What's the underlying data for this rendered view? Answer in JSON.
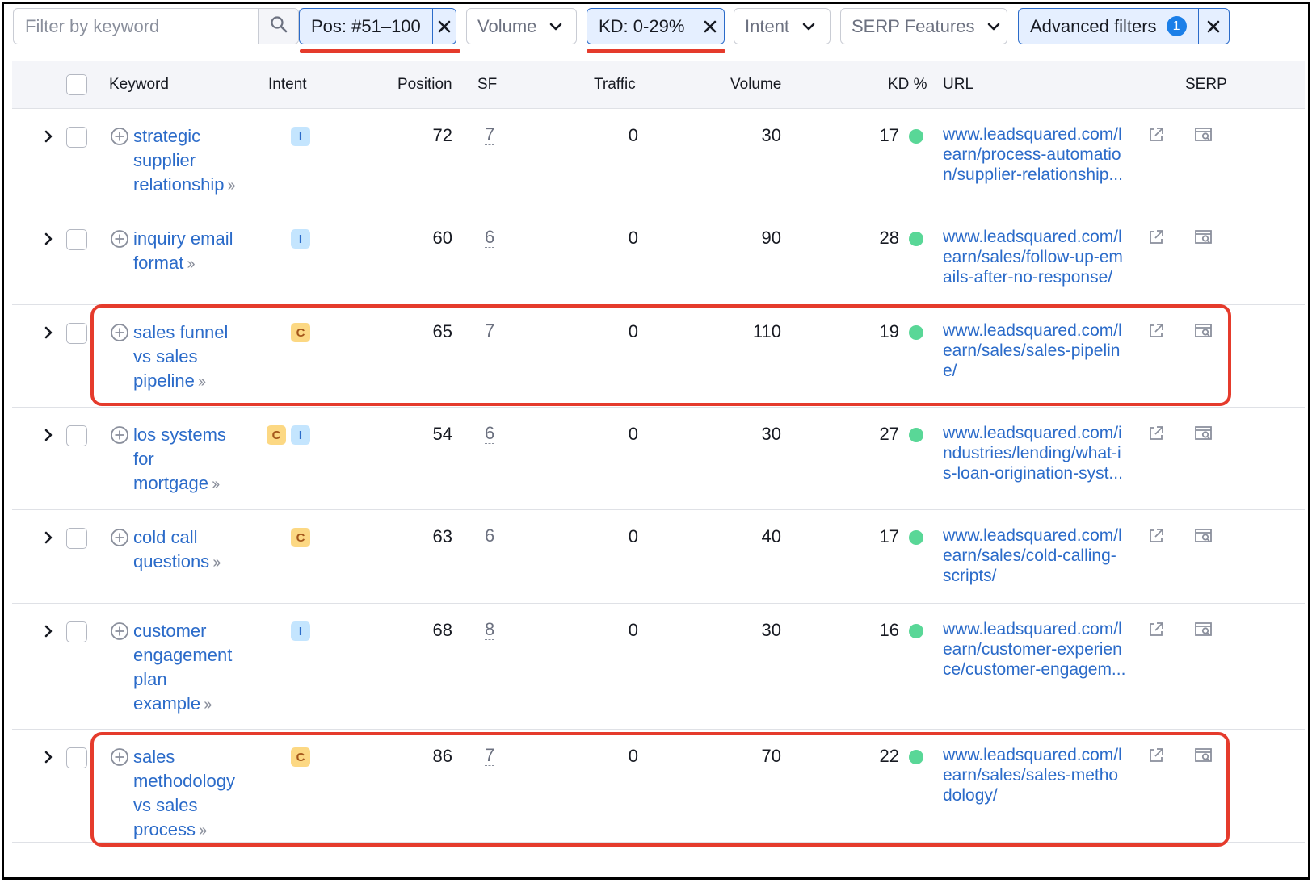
{
  "search": {
    "placeholder": "Filter by keyword"
  },
  "filters": {
    "position_chip": "Pos: #51–100",
    "volume_dropdown": "Volume",
    "kd_chip": "KD: 0-29%",
    "intent_dropdown": "Intent",
    "serp_dropdown": "SERP Features",
    "advanced_chip": "Advanced filters",
    "advanced_count": "1"
  },
  "table": {
    "headers": {
      "keyword": "Keyword",
      "intent": "Intent",
      "position": "Position",
      "sf": "SF",
      "traffic": "Traffic",
      "volume": "Volume",
      "kd": "KD %",
      "url": "URL",
      "serp": "SERP"
    },
    "rows": [
      {
        "keyword_lines": [
          "strategic",
          "supplier",
          "relationship"
        ],
        "intents": [
          "I"
        ],
        "position": "72",
        "sf": "7",
        "traffic": "0",
        "volume": "30",
        "kd": "17",
        "url_lines": [
          "www.leadsquared.com/l",
          "earn/process-automatio",
          "n/supplier-relationship..."
        ],
        "highlighted": false
      },
      {
        "keyword_lines": [
          "inquiry email",
          "format"
        ],
        "intents": [
          "I"
        ],
        "position": "60",
        "sf": "6",
        "traffic": "0",
        "volume": "90",
        "kd": "28",
        "url_lines": [
          "www.leadsquared.com/l",
          "earn/sales/follow-up-em",
          "ails-after-no-response/"
        ],
        "highlighted": false
      },
      {
        "keyword_lines": [
          "sales funnel",
          "vs sales",
          "pipeline"
        ],
        "intents": [
          "C"
        ],
        "position": "65",
        "sf": "7",
        "traffic": "0",
        "volume": "110",
        "kd": "19",
        "url_lines": [
          "www.leadsquared.com/l",
          "earn/sales/sales-pipelin",
          "e/"
        ],
        "highlighted": true
      },
      {
        "keyword_lines": [
          "los systems",
          "for",
          "mortgage"
        ],
        "intents": [
          "C",
          "I"
        ],
        "position": "54",
        "sf": "6",
        "traffic": "0",
        "volume": "30",
        "kd": "27",
        "url_lines": [
          "www.leadsquared.com/i",
          "ndustries/lending/what-i",
          "s-loan-origination-syst..."
        ],
        "highlighted": false
      },
      {
        "keyword_lines": [
          "cold call",
          "questions"
        ],
        "intents": [
          "C"
        ],
        "position": "63",
        "sf": "6",
        "traffic": "0",
        "volume": "40",
        "kd": "17",
        "url_lines": [
          "www.leadsquared.com/l",
          "earn/sales/cold-calling-",
          "scripts/"
        ],
        "highlighted": false
      },
      {
        "keyword_lines": [
          "customer",
          "engagement",
          "plan",
          "example"
        ],
        "intents": [
          "I"
        ],
        "position": "68",
        "sf": "8",
        "traffic": "0",
        "volume": "30",
        "kd": "16",
        "url_lines": [
          "www.leadsquared.com/l",
          "earn/customer-experien",
          "ce/customer-engagem..."
        ],
        "highlighted": false
      },
      {
        "keyword_lines": [
          "sales",
          "methodology",
          "vs sales",
          "process"
        ],
        "intents": [
          "C"
        ],
        "position": "86",
        "sf": "7",
        "traffic": "0",
        "volume": "70",
        "kd": "22",
        "url_lines": [
          "www.leadsquared.com/l",
          "earn/sales/sales-metho",
          "dology/"
        ],
        "highlighted": true
      }
    ]
  },
  "colors": {
    "link_blue": "#2b6bc9",
    "kd_easy_green": "#59d797",
    "annotation_red": "#e53b2c",
    "chip_active_bg": "#e5efff"
  },
  "icons": {
    "search": "magnifier-icon",
    "remove": "close-icon",
    "dropdown": "chevron-down-icon",
    "expand": "chevron-right-icon",
    "add_keyword": "plus-circle-icon",
    "open_url": "external-link-icon",
    "serp": "serp-snapshot-icon"
  }
}
